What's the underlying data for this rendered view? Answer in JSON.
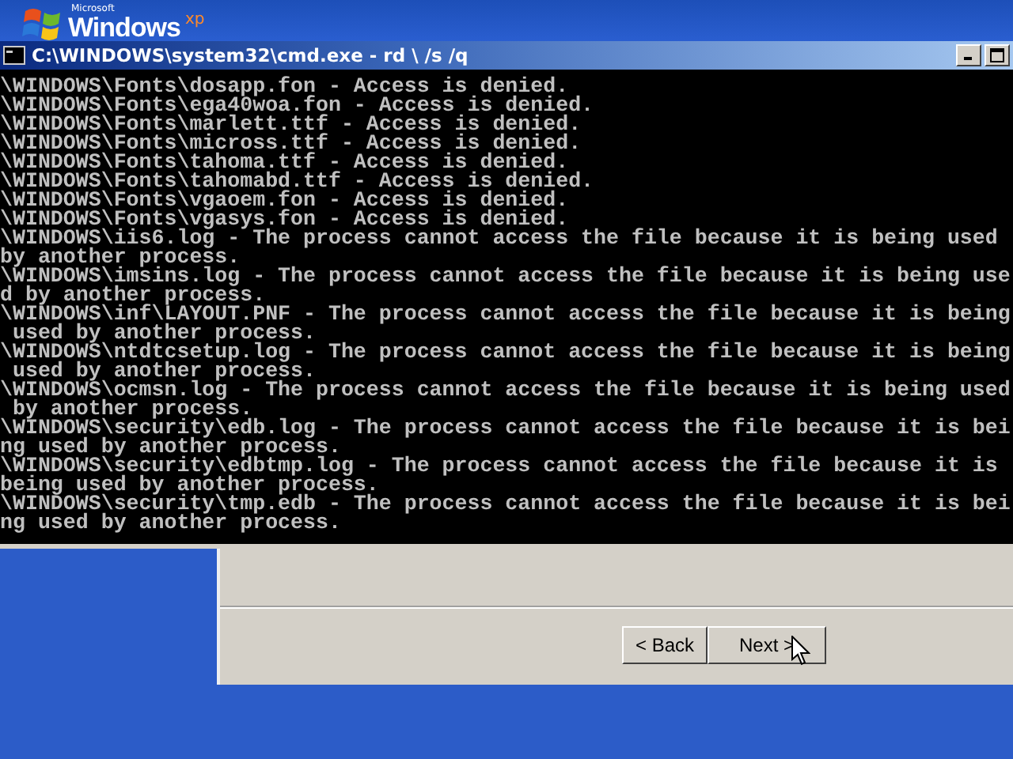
{
  "logo": {
    "company": "Microsoft",
    "product": "Windows",
    "edition": "xp"
  },
  "window": {
    "title": "C:\\WINDOWS\\system32\\cmd.exe - rd \\ /s /q"
  },
  "console": {
    "lines": [
      "\\WINDOWS\\Fonts\\dosapp.fon - Access is denied.",
      "\\WINDOWS\\Fonts\\ega40woa.fon - Access is denied.",
      "\\WINDOWS\\Fonts\\marlett.ttf - Access is denied.",
      "\\WINDOWS\\Fonts\\micross.ttf - Access is denied.",
      "\\WINDOWS\\Fonts\\tahoma.ttf - Access is denied.",
      "\\WINDOWS\\Fonts\\tahomabd.ttf - Access is denied.",
      "\\WINDOWS\\Fonts\\vgaoem.fon - Access is denied.",
      "\\WINDOWS\\Fonts\\vgasys.fon - Access is denied.",
      "\\WINDOWS\\iis6.log - The process cannot access the file because it is being used",
      "by another process.",
      "\\WINDOWS\\imsins.log - The process cannot access the file because it is being use",
      "d by another process.",
      "\\WINDOWS\\inf\\LAYOUT.PNF - The process cannot access the file because it is being",
      " used by another process.",
      "\\WINDOWS\\ntdtcsetup.log - The process cannot access the file because it is being",
      " used by another process.",
      "\\WINDOWS\\ocmsn.log - The process cannot access the file because it is being used",
      " by another process.",
      "\\WINDOWS\\security\\edb.log - The process cannot access the file because it is bei",
      "ng used by another process.",
      "\\WINDOWS\\security\\edbtmp.log - The process cannot access the file because it is",
      "being used by another process.",
      "\\WINDOWS\\security\\tmp.edb - The process cannot access the file because it is bei",
      "ng used by another process."
    ]
  },
  "wizard": {
    "buttons": [
      {
        "label": "< Back",
        "kind": "back"
      },
      {
        "label": "Next >",
        "kind": "next"
      }
    ]
  }
}
